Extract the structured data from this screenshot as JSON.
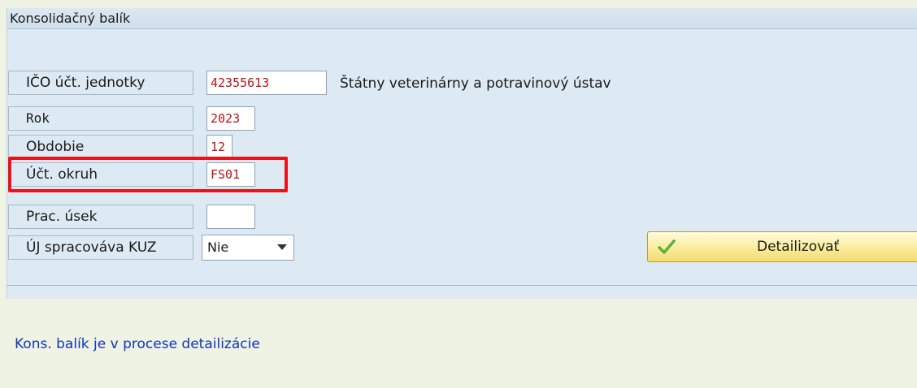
{
  "panel": {
    "title": "Konsolidačný balík"
  },
  "form": {
    "ico": {
      "label": "IČO účt. jednotky",
      "value": "42355613",
      "description": "Štátny veterinárny a potravinový ústav"
    },
    "rok": {
      "label": "Rok",
      "value": "2023"
    },
    "obdobie": {
      "label": "Obdobie",
      "value": "12"
    },
    "okruh": {
      "label": "Účt. okruh",
      "value": "FS01"
    },
    "usek": {
      "label": "Prac. úsek",
      "value": ""
    },
    "kuz": {
      "label": "ÚJ spracováva KUZ",
      "selected": "Nie"
    }
  },
  "actions": {
    "detail_label": "Detailizovať"
  },
  "status": {
    "message": "Kons. balík je v procese detailizácie"
  },
  "colors": {
    "value_text": "#c01010",
    "highlight": "#e8141c",
    "status_text": "#1533b8",
    "button_fill": "#fbec9a",
    "check_icon": "#2e9a1e"
  },
  "icons": {
    "detail_button_icon": "check-icon",
    "dropdown_icon": "chevron-down-icon"
  }
}
